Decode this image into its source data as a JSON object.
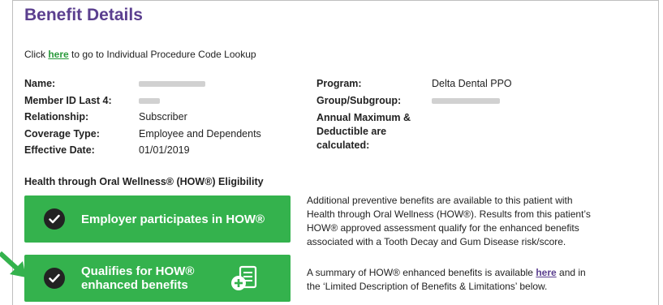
{
  "header": {
    "title": "Benefit Details"
  },
  "lookup": {
    "prefix": "Click",
    "link": "here",
    "suffix": "to go to Individual Procedure Code Lookup"
  },
  "member": {
    "name_label": "Name:",
    "member_id_label": "Member ID Last 4:",
    "relationship_label": "Relationship:",
    "relationship": "Subscriber",
    "coverage_label": "Coverage Type:",
    "coverage": "Employee and Dependents",
    "effective_label": "Effective Date:",
    "effective": "01/01/2019"
  },
  "plan": {
    "program_label": "Program:",
    "program": "Delta Dental PPO",
    "group_label": "Group/Subgroup:",
    "annual_line1": "Annual Maximum &",
    "annual_line2": "Deductible are",
    "annual_line3": "calculated:"
  },
  "how": {
    "heading": "Health through Oral Wellness® (HOW®) Eligibility",
    "employer_button": "Employer participates in HOW®",
    "qualifies_line1": "Qualifies for HOW®",
    "qualifies_line2": "enhanced benefits",
    "para1_line1": "Additional preventive benefits are available to this patient with",
    "para1_line2": "Health through Oral Wellness (HOW®). Results from this patient’s",
    "para1_line3": "HOW® approved assessment qualify for the enhanced benefits",
    "para1_line4": "associated with a Tooth Decay and Gum Disease risk/score.",
    "para2_prefix": "A summary of HOW® enhanced benefits is available",
    "para2_link": "here",
    "para2_suffix": "and in",
    "para2_line2": "the ‘Limited Description of Benefits & Limitations’ below."
  },
  "colors": {
    "accent": "#5b3f8f",
    "green": "#34b24d",
    "link_green": "#2a9a3c"
  },
  "icons": [
    "check-icon",
    "document-add-icon",
    "arrow-icon"
  ]
}
